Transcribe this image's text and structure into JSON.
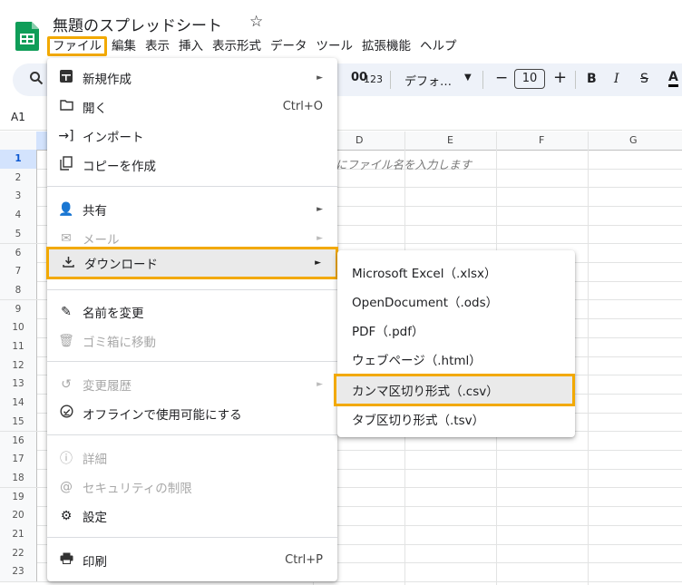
{
  "header": {
    "title": "無題のスプレッドシート",
    "star": "☆",
    "menus": [
      "ファイル",
      "編集",
      "表示",
      "挿入",
      "表示形式",
      "データ",
      "ツール",
      "拡張機能",
      "ヘルプ"
    ]
  },
  "toolbar": {
    "decimal": "00",
    "format_123": "123",
    "font": "デフォ…",
    "font_size": "10",
    "minus": "−",
    "plus": "+",
    "bold": "B",
    "italic": "I",
    "strike": "S",
    "text_color": "A"
  },
  "name_box": "A1",
  "grid": {
    "columns": [
      "D",
      "E",
      "F",
      "G"
    ],
    "rows": [
      "1",
      "2",
      "3",
      "4",
      "5",
      "6",
      "7",
      "8",
      "9",
      "10",
      "11",
      "12",
      "13",
      "14",
      "15",
      "16",
      "17",
      "18",
      "19",
      "20",
      "21",
      "22",
      "23"
    ],
    "cell_text": "にファイル名を入力します"
  },
  "file_menu": {
    "new": "新規作成",
    "open": "開く",
    "open_shortcut": "Ctrl+O",
    "import": "インポート",
    "copy": "コピーを作成",
    "share": "共有",
    "email": "メール",
    "download": "ダウンロード",
    "rename": "名前を変更",
    "trash": "ゴミ箱に移動",
    "history": "変更履歴",
    "offline": "オフラインで使用可能にする",
    "details": "詳細",
    "security": "セキュリティの制限",
    "settings": "設定",
    "print": "印刷",
    "print_shortcut": "Ctrl+P"
  },
  "download_menu": {
    "xlsx": "Microsoft Excel（.xlsx）",
    "ods": "OpenDocument（.ods）",
    "pdf": "PDF（.pdf）",
    "html": "ウェブページ（.html）",
    "csv": "カンマ区切り形式（.csv）",
    "tsv": "タブ区切り形式（.tsv）"
  },
  "colors": {
    "highlight": "#f2a900",
    "sheets_green": "#0f9d58"
  }
}
